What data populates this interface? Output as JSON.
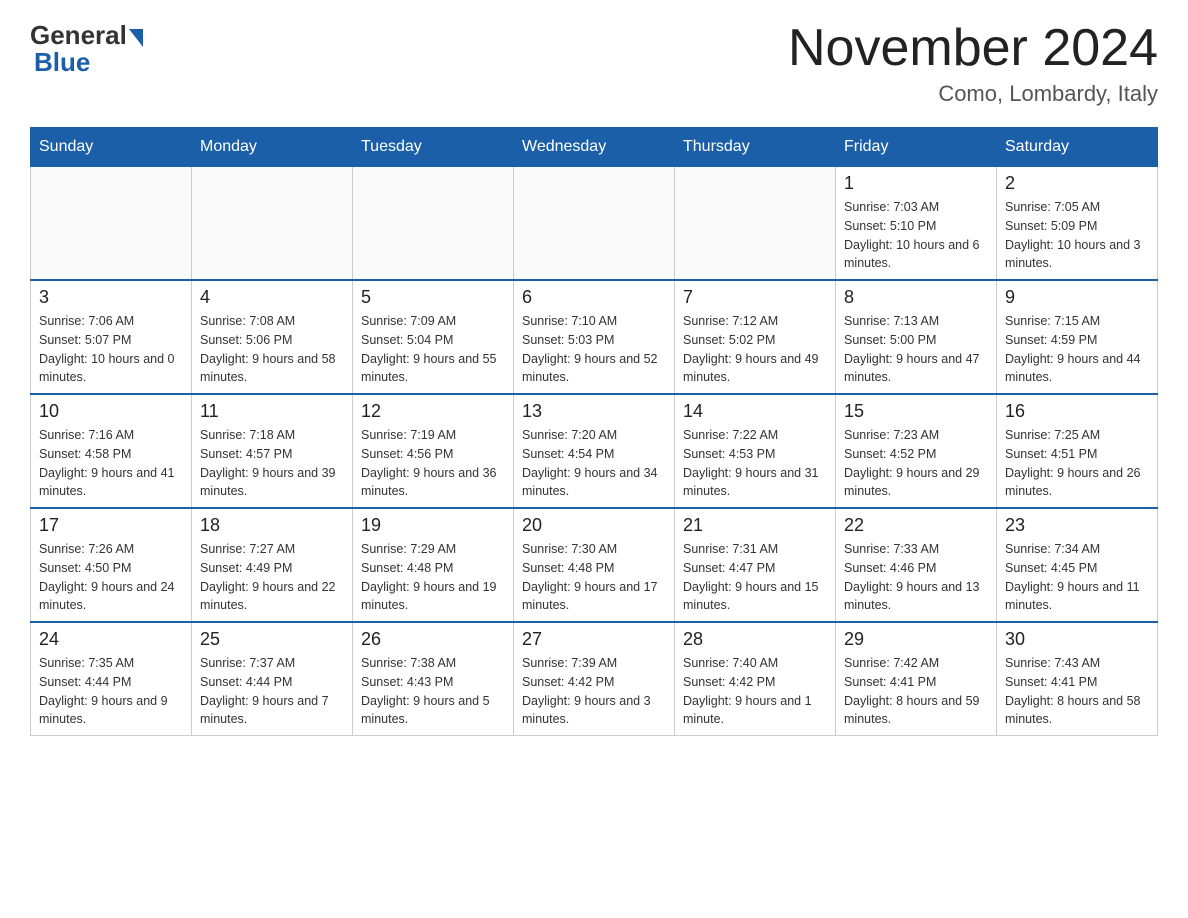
{
  "header": {
    "logo_general": "General",
    "logo_blue": "Blue",
    "title": "November 2024",
    "subtitle": "Como, Lombardy, Italy"
  },
  "days_of_week": [
    "Sunday",
    "Monday",
    "Tuesday",
    "Wednesday",
    "Thursday",
    "Friday",
    "Saturday"
  ],
  "weeks": [
    [
      {
        "day": "",
        "info": ""
      },
      {
        "day": "",
        "info": ""
      },
      {
        "day": "",
        "info": ""
      },
      {
        "day": "",
        "info": ""
      },
      {
        "day": "",
        "info": ""
      },
      {
        "day": "1",
        "info": "Sunrise: 7:03 AM\nSunset: 5:10 PM\nDaylight: 10 hours and 6 minutes."
      },
      {
        "day": "2",
        "info": "Sunrise: 7:05 AM\nSunset: 5:09 PM\nDaylight: 10 hours and 3 minutes."
      }
    ],
    [
      {
        "day": "3",
        "info": "Sunrise: 7:06 AM\nSunset: 5:07 PM\nDaylight: 10 hours and 0 minutes."
      },
      {
        "day": "4",
        "info": "Sunrise: 7:08 AM\nSunset: 5:06 PM\nDaylight: 9 hours and 58 minutes."
      },
      {
        "day": "5",
        "info": "Sunrise: 7:09 AM\nSunset: 5:04 PM\nDaylight: 9 hours and 55 minutes."
      },
      {
        "day": "6",
        "info": "Sunrise: 7:10 AM\nSunset: 5:03 PM\nDaylight: 9 hours and 52 minutes."
      },
      {
        "day": "7",
        "info": "Sunrise: 7:12 AM\nSunset: 5:02 PM\nDaylight: 9 hours and 49 minutes."
      },
      {
        "day": "8",
        "info": "Sunrise: 7:13 AM\nSunset: 5:00 PM\nDaylight: 9 hours and 47 minutes."
      },
      {
        "day": "9",
        "info": "Sunrise: 7:15 AM\nSunset: 4:59 PM\nDaylight: 9 hours and 44 minutes."
      }
    ],
    [
      {
        "day": "10",
        "info": "Sunrise: 7:16 AM\nSunset: 4:58 PM\nDaylight: 9 hours and 41 minutes."
      },
      {
        "day": "11",
        "info": "Sunrise: 7:18 AM\nSunset: 4:57 PM\nDaylight: 9 hours and 39 minutes."
      },
      {
        "day": "12",
        "info": "Sunrise: 7:19 AM\nSunset: 4:56 PM\nDaylight: 9 hours and 36 minutes."
      },
      {
        "day": "13",
        "info": "Sunrise: 7:20 AM\nSunset: 4:54 PM\nDaylight: 9 hours and 34 minutes."
      },
      {
        "day": "14",
        "info": "Sunrise: 7:22 AM\nSunset: 4:53 PM\nDaylight: 9 hours and 31 minutes."
      },
      {
        "day": "15",
        "info": "Sunrise: 7:23 AM\nSunset: 4:52 PM\nDaylight: 9 hours and 29 minutes."
      },
      {
        "day": "16",
        "info": "Sunrise: 7:25 AM\nSunset: 4:51 PM\nDaylight: 9 hours and 26 minutes."
      }
    ],
    [
      {
        "day": "17",
        "info": "Sunrise: 7:26 AM\nSunset: 4:50 PM\nDaylight: 9 hours and 24 minutes."
      },
      {
        "day": "18",
        "info": "Sunrise: 7:27 AM\nSunset: 4:49 PM\nDaylight: 9 hours and 22 minutes."
      },
      {
        "day": "19",
        "info": "Sunrise: 7:29 AM\nSunset: 4:48 PM\nDaylight: 9 hours and 19 minutes."
      },
      {
        "day": "20",
        "info": "Sunrise: 7:30 AM\nSunset: 4:48 PM\nDaylight: 9 hours and 17 minutes."
      },
      {
        "day": "21",
        "info": "Sunrise: 7:31 AM\nSunset: 4:47 PM\nDaylight: 9 hours and 15 minutes."
      },
      {
        "day": "22",
        "info": "Sunrise: 7:33 AM\nSunset: 4:46 PM\nDaylight: 9 hours and 13 minutes."
      },
      {
        "day": "23",
        "info": "Sunrise: 7:34 AM\nSunset: 4:45 PM\nDaylight: 9 hours and 11 minutes."
      }
    ],
    [
      {
        "day": "24",
        "info": "Sunrise: 7:35 AM\nSunset: 4:44 PM\nDaylight: 9 hours and 9 minutes."
      },
      {
        "day": "25",
        "info": "Sunrise: 7:37 AM\nSunset: 4:44 PM\nDaylight: 9 hours and 7 minutes."
      },
      {
        "day": "26",
        "info": "Sunrise: 7:38 AM\nSunset: 4:43 PM\nDaylight: 9 hours and 5 minutes."
      },
      {
        "day": "27",
        "info": "Sunrise: 7:39 AM\nSunset: 4:42 PM\nDaylight: 9 hours and 3 minutes."
      },
      {
        "day": "28",
        "info": "Sunrise: 7:40 AM\nSunset: 4:42 PM\nDaylight: 9 hours and 1 minute."
      },
      {
        "day": "29",
        "info": "Sunrise: 7:42 AM\nSunset: 4:41 PM\nDaylight: 8 hours and 59 minutes."
      },
      {
        "day": "30",
        "info": "Sunrise: 7:43 AM\nSunset: 4:41 PM\nDaylight: 8 hours and 58 minutes."
      }
    ]
  ]
}
